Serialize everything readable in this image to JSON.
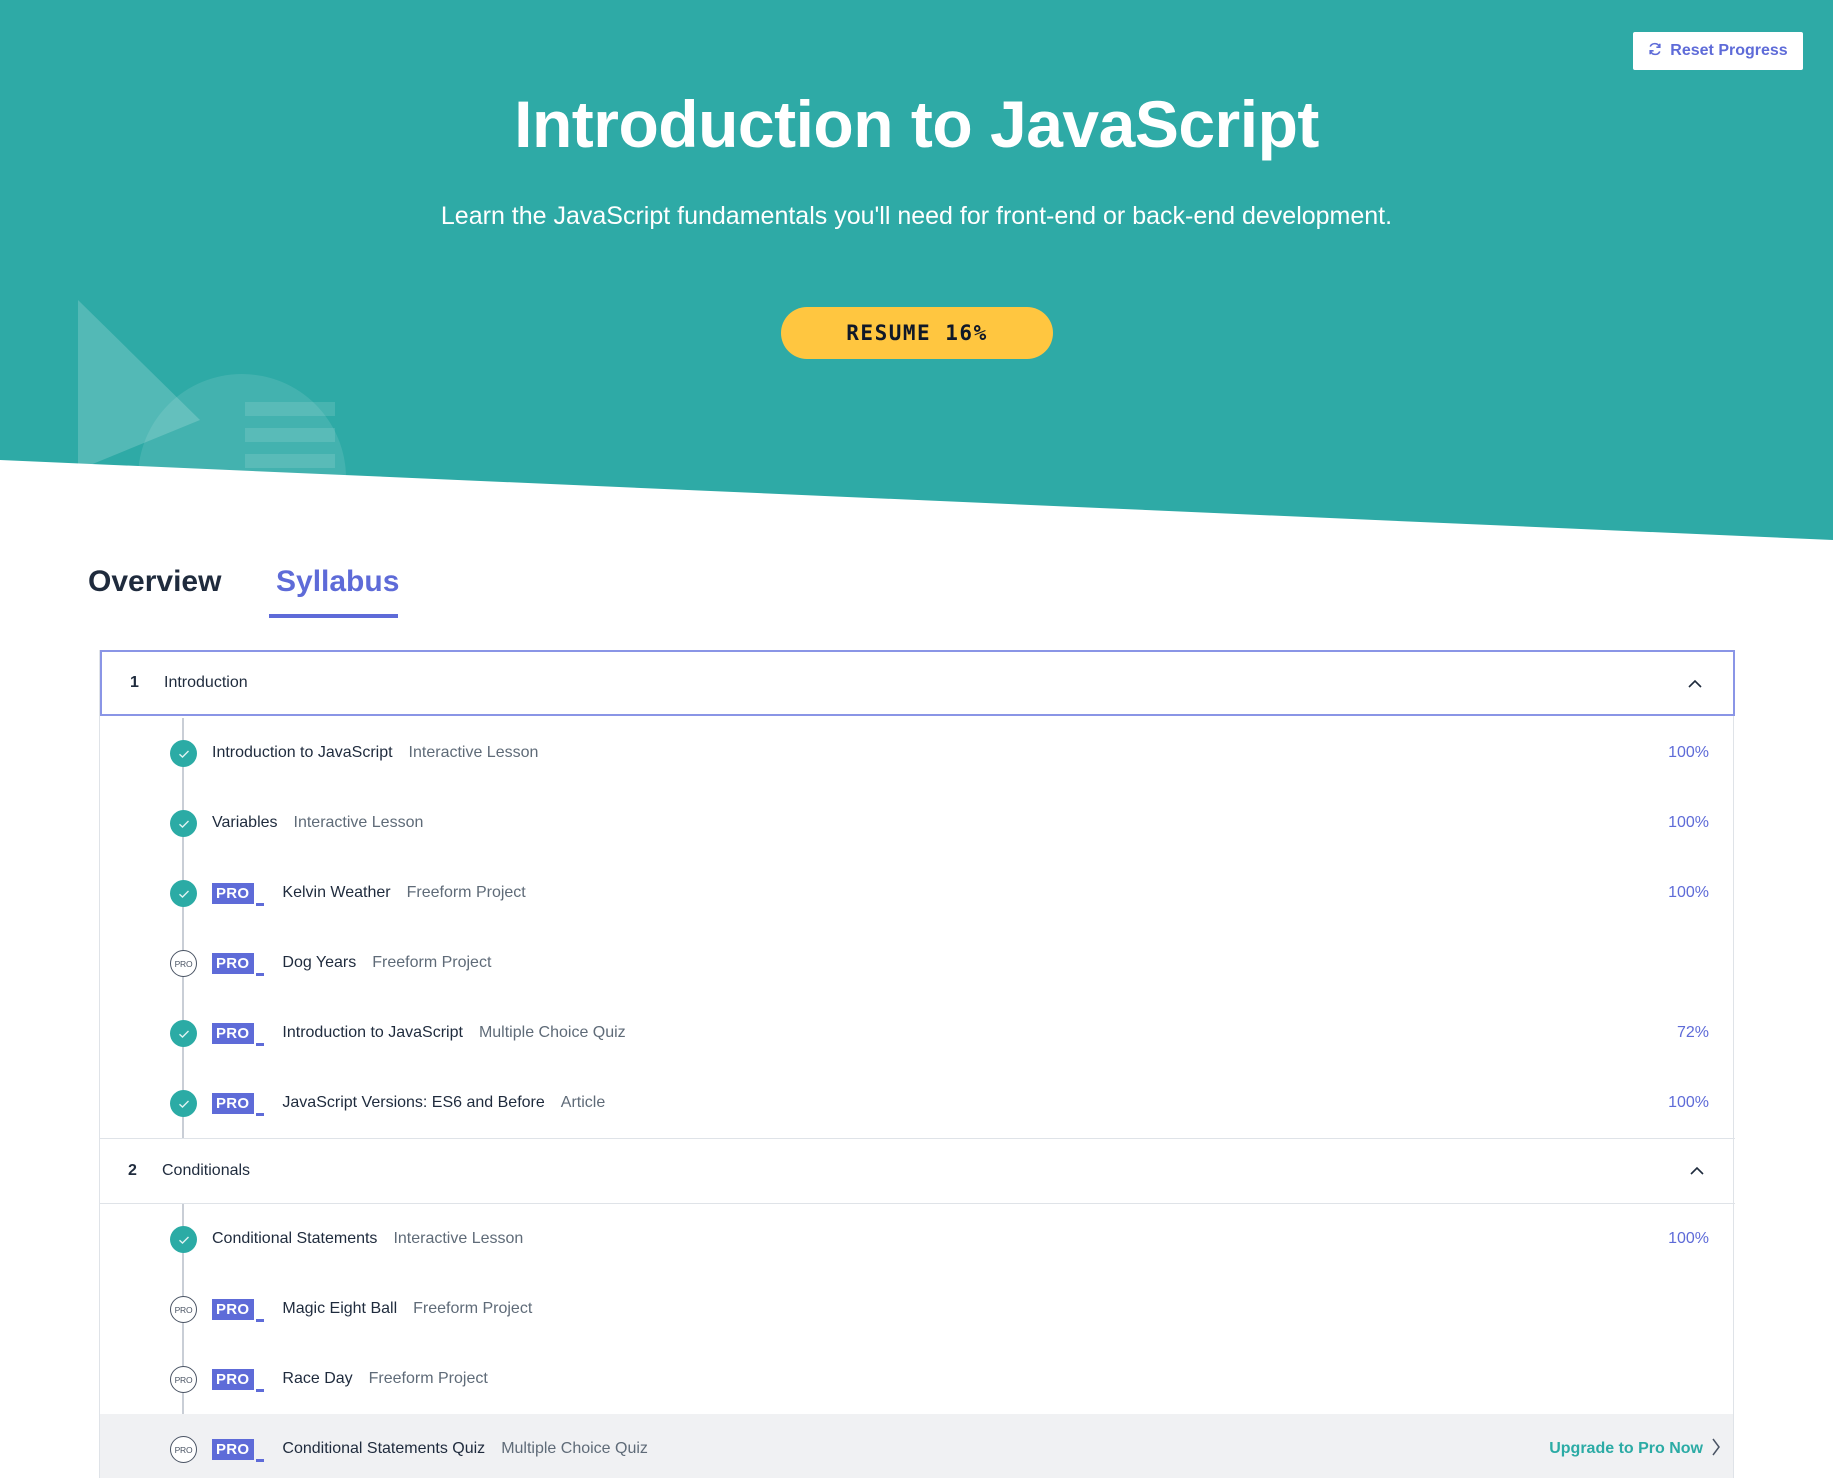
{
  "header": {
    "reset_label": "Reset Progress",
    "reset_icon": "refresh-icon",
    "title": "Introduction to JavaScript",
    "subtitle": "Learn the JavaScript fundamentals you'll need for front-end or back-end development.",
    "resume_label": "RESUME 16%",
    "progress_percent": 16
  },
  "tabs": [
    {
      "label": "Overview",
      "active": false
    },
    {
      "label": "Syllabus",
      "active": true
    }
  ],
  "pro_badge": "PRO",
  "pro_status_label": "PRO",
  "sections": [
    {
      "number": "1",
      "title": "Introduction",
      "expanded": true,
      "items": [
        {
          "title": "Introduction to JavaScript",
          "type": "Interactive Lesson",
          "progress": "100%",
          "status": "completed",
          "pro": false
        },
        {
          "title": "Variables",
          "type": "Interactive Lesson",
          "progress": "100%",
          "status": "completed",
          "pro": false
        },
        {
          "title": "Kelvin Weather",
          "type": "Freeform Project",
          "progress": "100%",
          "status": "completed",
          "pro": true
        },
        {
          "title": "Dog Years",
          "type": "Freeform Project",
          "progress": "",
          "status": "locked",
          "pro": true
        },
        {
          "title": "Introduction to JavaScript",
          "type": "Multiple Choice Quiz",
          "progress": "72%",
          "status": "completed",
          "pro": true
        },
        {
          "title": "JavaScript Versions: ES6 and Before",
          "type": "Article",
          "progress": "100%",
          "status": "completed",
          "pro": true
        }
      ]
    },
    {
      "number": "2",
      "title": "Conditionals",
      "expanded": true,
      "items": [
        {
          "title": "Conditional Statements",
          "type": "Interactive Lesson",
          "progress": "100%",
          "status": "completed",
          "pro": false
        },
        {
          "title": "Magic Eight Ball",
          "type": "Freeform Project",
          "progress": "",
          "status": "locked",
          "pro": true
        },
        {
          "title": "Race Day",
          "type": "Freeform Project",
          "progress": "",
          "status": "locked",
          "pro": true
        },
        {
          "title": "Conditional Statements Quiz",
          "type": "Multiple Choice Quiz",
          "progress": "",
          "status": "locked",
          "pro": true,
          "upgrade_label": "Upgrade to Pro Now"
        }
      ]
    }
  ],
  "colors": {
    "hero_bg": "#2eaaa6",
    "accent": "#5e6bd8",
    "resume_bg": "#ffc640",
    "complete": "#2baba5"
  }
}
